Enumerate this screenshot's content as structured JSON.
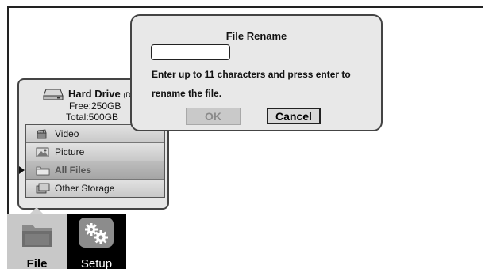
{
  "storage_panel": {
    "drive_name": "Hard Drive",
    "drive_suffix": "(De",
    "free": "Free:250GB",
    "total": "Total:500GB",
    "menu": [
      {
        "label": "Video",
        "icon": "video-icon",
        "selected": false
      },
      {
        "label": "Picture",
        "icon": "picture-icon",
        "selected": false
      },
      {
        "label": "All Files",
        "icon": "folder-icon",
        "selected": true
      },
      {
        "label": "Other Storage",
        "icon": "storage-icon",
        "selected": false
      }
    ]
  },
  "bottom_tabs": {
    "file": {
      "label": "File",
      "icon": "folder-icon",
      "active": true
    },
    "setup": {
      "label": "Setup",
      "icon": "gears-icon",
      "active": false
    }
  },
  "dialog": {
    "title": "File Rename",
    "input_value": "",
    "message_line1": "Enter up to 11 characters and press enter to",
    "message_line2": "rename the file.",
    "ok_label": "OK",
    "ok_disabled": true,
    "cancel_label": "Cancel"
  },
  "colors": {
    "dialog_bg": "#e8e8e8",
    "setup_tile_bg": "#000000",
    "file_tile_bg": "#c8c8c8"
  }
}
